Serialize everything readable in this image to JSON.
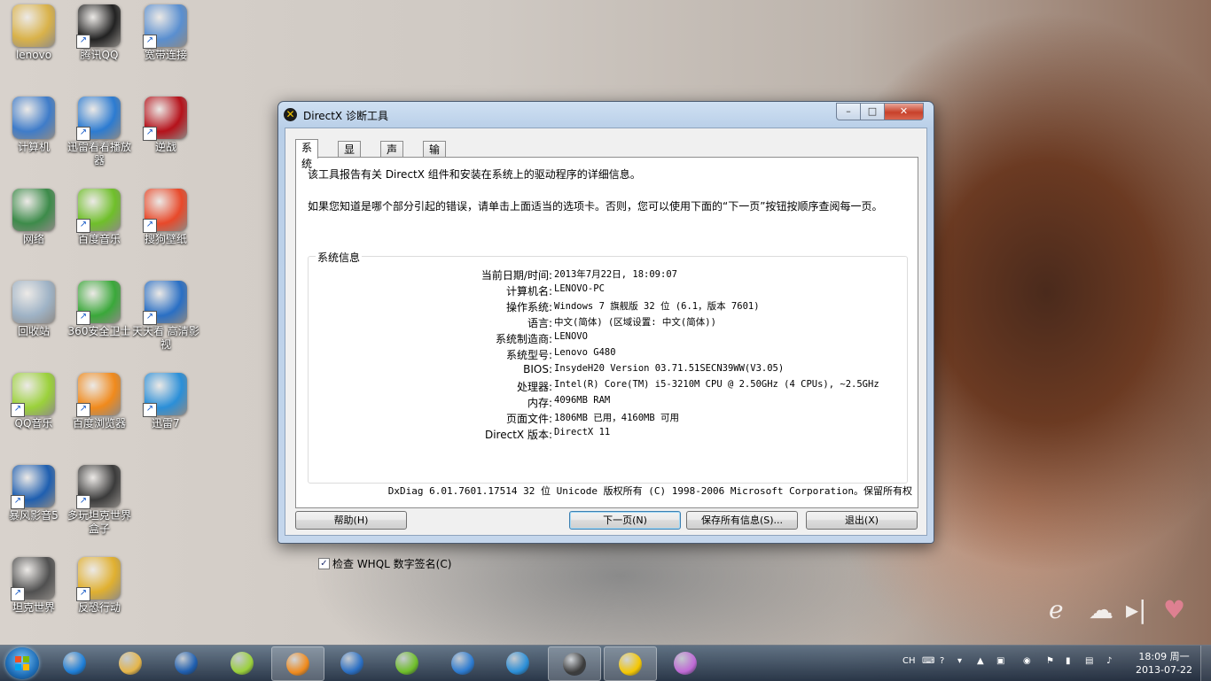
{
  "desktop": {
    "icons": [
      {
        "label": "lenovo",
        "icon": "user-folder-icon",
        "color": "#d9b24a"
      },
      {
        "label": "腾讯QQ",
        "icon": "qq-penguin-icon",
        "color": "#222222"
      },
      {
        "label": "宽带连接",
        "icon": "network-connection-icon",
        "color": "#5a8fd0"
      },
      {
        "label": "计算机",
        "icon": "computer-icon",
        "color": "#3f7cc9"
      },
      {
        "label": "迅雷看看播放器",
        "icon": "xunlei-kankan-icon",
        "color": "#2c7bd1"
      },
      {
        "label": "逆战",
        "icon": "game-nizhan-icon",
        "color": "#b5121b"
      },
      {
        "label": "网络",
        "icon": "globe-network-icon",
        "color": "#3d8b4a"
      },
      {
        "label": "百度音乐",
        "icon": "music-player-icon",
        "color": "#6fbf2a"
      },
      {
        "label": "搜狗壁纸",
        "icon": "sogou-wallpaper-icon",
        "color": "#e8492a"
      },
      {
        "label": "回收站",
        "icon": "recycle-bin-icon",
        "color": "#9fb3c6"
      },
      {
        "label": "360安全卫士",
        "icon": "360-security-icon",
        "color": "#3aa83a"
      },
      {
        "label": "天天看 高清影视",
        "icon": "video-player-icon",
        "color": "#2a6fc4"
      },
      {
        "label": "QQ音乐",
        "icon": "qq-music-icon",
        "color": "#9bd13b"
      },
      {
        "label": "百度浏览器",
        "icon": "baidu-browser-icon",
        "color": "#f08a1c"
      },
      {
        "label": "迅雷7",
        "icon": "xunlei-bird-icon",
        "color": "#2b8fd8"
      },
      {
        "label": "暴风影音5",
        "icon": "baofeng-player-icon",
        "color": "#1f5fb0"
      },
      {
        "label": "多玩坦克世界盒子",
        "icon": "tank-box-icon",
        "color": "#3b3b3b"
      },
      {
        "label": "坦克世界",
        "icon": "world-of-tanks-icon",
        "color": "#505050"
      },
      {
        "label": "反恐行动",
        "icon": "game-mat-icon",
        "color": "#e0b030"
      }
    ]
  },
  "window": {
    "title": "DirectX 诊断工具",
    "controls": {
      "minimize": "–",
      "maximize": "□",
      "close": "✕"
    },
    "tabs": [
      "系统",
      "显示",
      "声音",
      "输入"
    ],
    "active_tab": "系统",
    "intro_line1": "该工具报告有关 DirectX 组件和安装在系统上的驱动程序的详细信息。",
    "intro_line2": "如果您知道是哪个部分引起的错误，请单击上面适当的选项卡。否则，您可以使用下面的“下一页”按钮按顺序查阅每一页。",
    "group_title": "系统信息",
    "system_info": [
      {
        "label": "当前日期/时间:",
        "value": "2013年7月22日, 18:09:07"
      },
      {
        "label": "计算机名:",
        "value": "LENOVO-PC"
      },
      {
        "label": "操作系统:",
        "value": "Windows 7 旗舰版 32 位 (6.1，版本 7601)"
      },
      {
        "label": "语言:",
        "value": "中文(简体) (区域设置: 中文(简体))"
      },
      {
        "label": "系统制造商:",
        "value": "LENOVO"
      },
      {
        "label": "系统型号:",
        "value": "Lenovo G480"
      },
      {
        "label": "BIOS:",
        "value": "InsydeH20 Version 03.71.51SECN39WW(V3.05)"
      },
      {
        "label": "处理器:",
        "value": "Intel(R) Core(TM) i5-3210M CPU @ 2.50GHz (4 CPUs), ~2.5GHz"
      },
      {
        "label": "内存:",
        "value": "4096MB RAM"
      },
      {
        "label": "页面文件:",
        "value": "1806MB 已用，4160MB 可用"
      },
      {
        "label": "DirectX 版本:",
        "value": "DirectX 11"
      }
    ],
    "whql_check": {
      "label": "检查 WHQL 数字签名(C)",
      "checked": true
    },
    "copyright": "DxDiag 6.01.7601.17514 32 位 Unicode 版权所有 (C) 1998-2006 Microsoft Corporation。保留所有权",
    "buttons": {
      "help": "帮助(H)",
      "next": "下一页(N)",
      "save": "保存所有信息(S)...",
      "exit": "退出(X)"
    }
  },
  "taskbar": {
    "pinned": [
      {
        "name": "ie-icon",
        "color": "#1e7fd8"
      },
      {
        "name": "explorer-icon",
        "color": "#e6b64a"
      },
      {
        "name": "baofeng-icon",
        "color": "#1f5fb0"
      },
      {
        "name": "qqmusic-icon",
        "color": "#9bd13b"
      },
      {
        "name": "baidu-browser-icon",
        "color": "#f08a1c"
      },
      {
        "name": "video-player-icon",
        "color": "#2a6fc4"
      },
      {
        "name": "baidu-music-icon",
        "color": "#6fbf2a"
      },
      {
        "name": "xunlei-kankan-icon",
        "color": "#2c7bd1"
      },
      {
        "name": "xunlei-bird-icon",
        "color": "#2b8fd8"
      },
      {
        "name": "tank-box-icon",
        "color": "#3b3b3b"
      },
      {
        "name": "directx-icon",
        "color": "#f5c700"
      },
      {
        "name": "paint-icon",
        "color": "#c06ad6"
      }
    ],
    "tray": {
      "lang": "CH",
      "time": "18:09 周一",
      "date": "2013-07-22"
    }
  }
}
